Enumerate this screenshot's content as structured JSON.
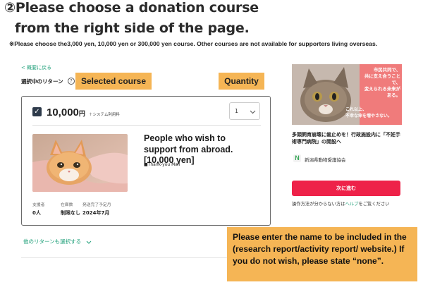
{
  "header": {
    "line1": "②Please choose a donation course",
    "line2": "from the right side of the page.",
    "note": "※Please choose the3,000 yen, 10,000 yen  or 300,000 yen course. Other courses are not available for supporters living overseas."
  },
  "left": {
    "back_link": "< 概要に戻る",
    "selected_label": "選択中のリターン",
    "help_icon": "?",
    "tag_selected": "Selected course",
    "tag_quantity": "Quantity",
    "price": "10,000",
    "price_unit": "円",
    "price_fee": "＋システム利用料",
    "qty_value": "1",
    "return_title": "People who wish to support from abroad. [10,000 yen]",
    "return_item": "■Thank-you Mail",
    "stats": [
      {
        "label": "支援者",
        "value": "0人"
      },
      {
        "label": "在庫数",
        "value": "制限なし"
      },
      {
        "label": "発送完了予定月",
        "value": "2024年7月"
      }
    ],
    "other_link": "他のリターンも選択する",
    "instruction": "Please enter the name to be included in the (research report/activity report/ website.) If you do not wish, please state “none”."
  },
  "right": {
    "banner_text_1": "市民共同で、",
    "banner_text_2": "共に支え合うことで、",
    "banner_text_3": "変えられる未来がある。",
    "banner_text_4": "これ以上、",
    "banner_text_5": "不幸な命を増やさない。",
    "project_title": "多頭飼育崩壊に歯止めを！行政施設内に「不妊手術専門病院」の開設へ",
    "org_logo": "N",
    "org_name": "新潟県動物愛護協会",
    "next_button": "次に進む",
    "help_prefix": "操作方法が分からない方は",
    "help_link": "ヘルプ",
    "help_suffix": "をご覧ください"
  },
  "icons": {
    "checkbox": "check-icon",
    "qty": "chevron-down-icon",
    "other": "chevron-down-icon"
  },
  "colors": {
    "tag_bg": "#f5b555",
    "accent_green": "#20a07a",
    "next_button": "#ee2249",
    "banner": "#f07b7b"
  }
}
